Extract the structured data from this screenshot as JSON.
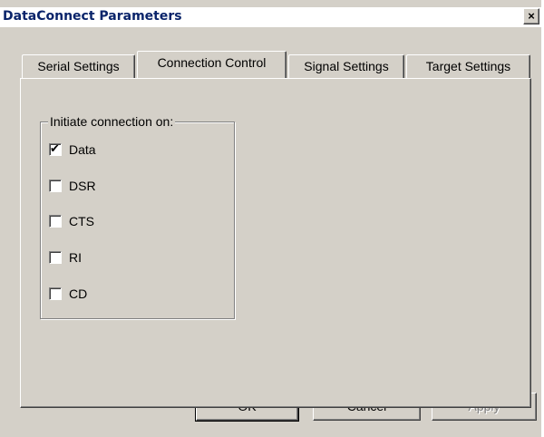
{
  "window": {
    "title": "DataConnect Parameters",
    "close_glyph": "×"
  },
  "tabs": [
    {
      "label": "Serial Settings",
      "active": false
    },
    {
      "label": "Connection Control",
      "active": true
    },
    {
      "label": "Signal Settings",
      "active": false
    },
    {
      "label": "Target Settings",
      "active": false
    }
  ],
  "group": {
    "label": "Initiate connection on:",
    "options": [
      {
        "label": "Data",
        "checked": true
      },
      {
        "label": "DSR",
        "checked": false
      },
      {
        "label": "CTS",
        "checked": false
      },
      {
        "label": "RI",
        "checked": false
      },
      {
        "label": "CD",
        "checked": false
      }
    ],
    "check_glyph": "✔"
  },
  "buttons": {
    "ok": "OK",
    "cancel": "Cancel",
    "apply": "Apply"
  }
}
